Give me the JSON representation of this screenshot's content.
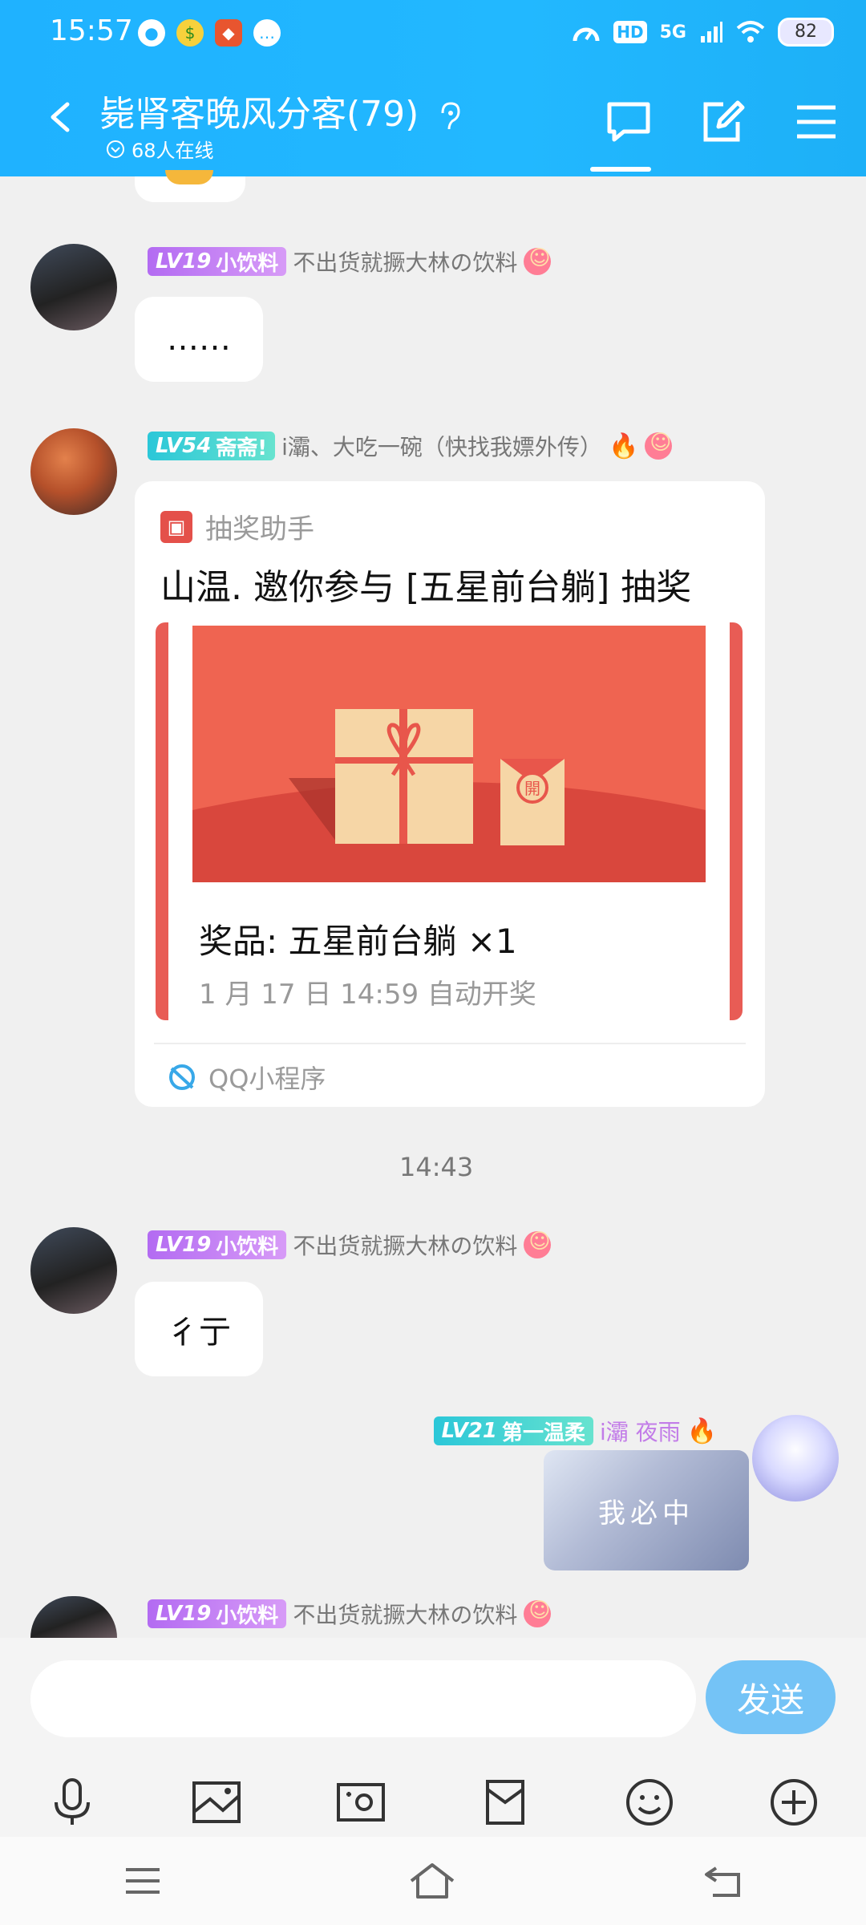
{
  "status_bar": {
    "time": "15:57",
    "battery": "82",
    "network": "5G",
    "hd": "HD"
  },
  "header": {
    "title": "毙肾客晚风分客(79)",
    "online": "68人在线"
  },
  "messages": [
    {
      "level": "LV19",
      "tag": "小饮料",
      "nickname": "不出货就撅大林の饮料",
      "text": "……"
    },
    {
      "level": "LV54",
      "tag": "斋斋!",
      "nickname": "i灞、大吃一碗（快找我嫖外传）",
      "card": {
        "source": "抽奖助手",
        "title": "山温. 邀你参与 [五星前台躺] 抽奖",
        "prize": "奖品: 五星前台躺 ×1",
        "draw_time": "1 月 17 日 14:59 自动开奖",
        "footer": "QQ小程序",
        "seal": "開"
      }
    },
    {
      "level": "LV19",
      "tag": "小饮料",
      "nickname": "不出货就撅大林の饮料",
      "text": "彳亍"
    },
    {
      "level": "LV21",
      "tag": "第一温柔",
      "nickname": "i灞 夜雨",
      "sticker_text": "我必中",
      "self": true
    },
    {
      "level": "LV19",
      "tag": "小饮料",
      "nickname": "不出货就撅大林の饮料"
    }
  ],
  "timestamp": "14:43",
  "input": {
    "placeholder": "",
    "value": "",
    "send_label": "发送"
  },
  "colors": {
    "header": "#1fb2ff",
    "card_red": "#ef6451",
    "send": "#74c3f6"
  }
}
